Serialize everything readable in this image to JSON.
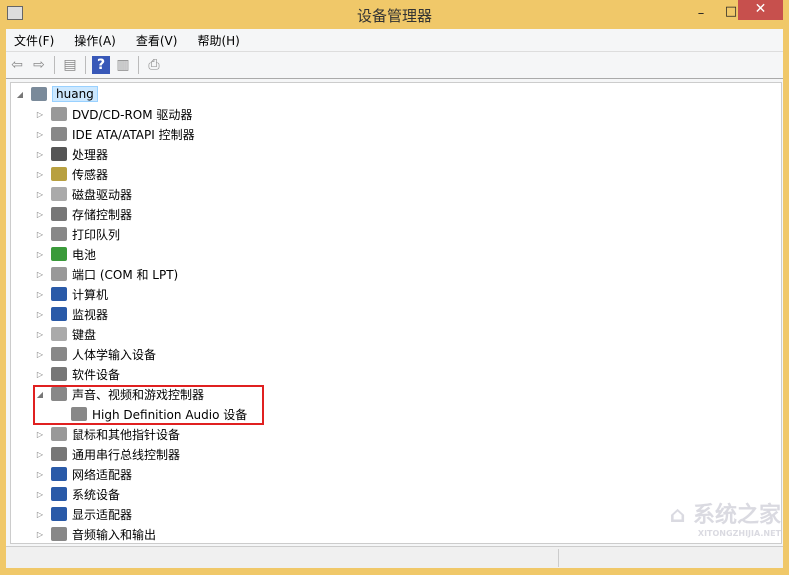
{
  "window": {
    "title": "设备管理器",
    "minimize": "–",
    "maximize": "□",
    "close": "✕"
  },
  "menu": [
    "文件(F)",
    "操作(A)",
    "查看(V)",
    "帮助(H)"
  ],
  "toolbar": [
    {
      "icon": "back-arrow-icon",
      "glyph": "⇦"
    },
    {
      "icon": "forward-arrow-icon",
      "glyph": "⇨"
    },
    {
      "sep": true
    },
    {
      "icon": "show-hide-console-tree-icon",
      "glyph": "▤"
    },
    {
      "sep": true
    },
    {
      "icon": "help-icon",
      "glyph": "?"
    },
    {
      "icon": "show-action-pane-icon",
      "glyph": "▥"
    },
    {
      "sep": true
    },
    {
      "icon": "scan-hardware-icon",
      "glyph": "⎙"
    }
  ],
  "tree": {
    "root": "huang",
    "items": [
      {
        "label": "DVD/CD-ROM 驱动器",
        "color": "#999"
      },
      {
        "label": "IDE ATA/ATAPI 控制器",
        "color": "#888"
      },
      {
        "label": "处理器",
        "color": "#555"
      },
      {
        "label": "传感器",
        "color": "#b8a040"
      },
      {
        "label": "磁盘驱动器",
        "color": "#aaa"
      },
      {
        "label": "存储控制器",
        "color": "#777"
      },
      {
        "label": "打印队列",
        "color": "#888"
      },
      {
        "label": "电池",
        "color": "#3a9a3a"
      },
      {
        "label": "端口 (COM 和 LPT)",
        "color": "#999"
      },
      {
        "label": "计算机",
        "color": "#2a5aa8"
      },
      {
        "label": "监视器",
        "color": "#2a5aa8"
      },
      {
        "label": "键盘",
        "color": "#aaa"
      },
      {
        "label": "人体学输入设备",
        "color": "#888"
      },
      {
        "label": "软件设备",
        "color": "#777"
      },
      {
        "label": "声音、视频和游戏控制器",
        "color": "#888",
        "expanded": true,
        "children": [
          "High Definition Audio 设备"
        ]
      },
      {
        "label": "鼠标和其他指针设备",
        "color": "#999"
      },
      {
        "label": "通用串行总线控制器",
        "color": "#777"
      },
      {
        "label": "网络适配器",
        "color": "#2a5aa8"
      },
      {
        "label": "系统设备",
        "color": "#2a5aa8"
      },
      {
        "label": "显示适配器",
        "color": "#2a5aa8"
      },
      {
        "label": "音频输入和输出",
        "color": "#888"
      }
    ]
  },
  "watermark": {
    "text": "系统之家",
    "sub": "XITONGZHIJIA.NET"
  },
  "colors": {
    "titlebar": "#f0c869",
    "close": "#c7504d",
    "highlight": "#e02020"
  }
}
